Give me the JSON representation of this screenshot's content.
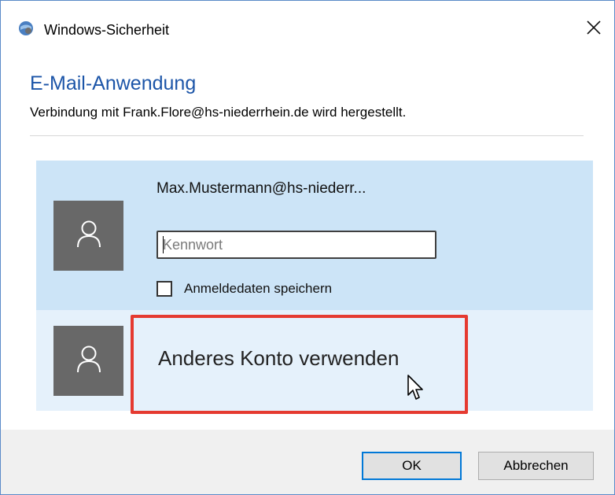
{
  "window": {
    "title": "Windows-Sicherheit",
    "app_icon": "windows-security-icon",
    "close_icon": "close-icon"
  },
  "dialog": {
    "heading": "E-Mail-Anwendung",
    "subtitle": "Verbindung mit Frank.Flore@hs-niederrhein.de wird hergestellt."
  },
  "accounts": {
    "selected": {
      "name": "Max.Mustermann@hs-niederr...",
      "avatar_icon": "user-icon",
      "password_placeholder": "Kennwort",
      "password_value": "",
      "remember_label": "Anmeldedaten speichern",
      "remember_checked": false
    },
    "other": {
      "label": "Anderes Konto verwenden",
      "avatar_icon": "user-icon"
    }
  },
  "footer": {
    "ok_label": "OK",
    "cancel_label": "Abbrechen"
  },
  "colors": {
    "heading": "#1c55a8",
    "selected_bg": "#cce4f7",
    "other_bg": "#e5f1fb",
    "avatar_bg": "#686868",
    "highlight": "#e53a30",
    "ok_border": "#0078d7"
  }
}
